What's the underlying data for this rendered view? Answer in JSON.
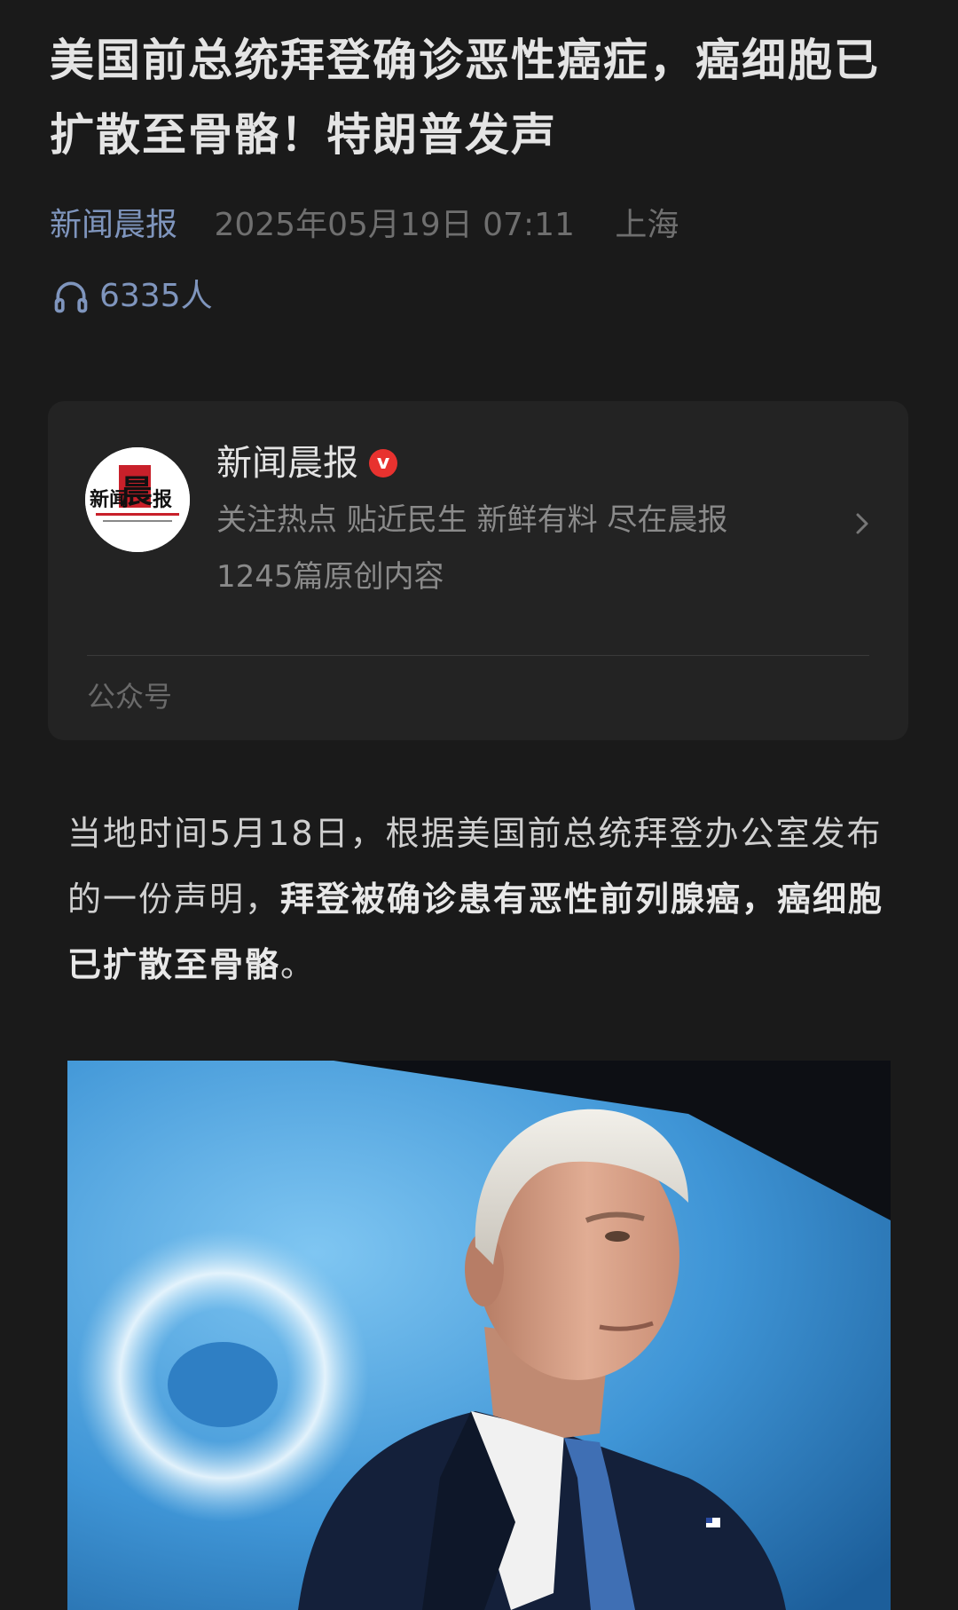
{
  "article": {
    "title": "美国前总统拜登确诊恶性癌症，癌细胞已扩散至骨骼！特朗普发声",
    "source": "新闻晨报",
    "date": "2025年05月19日 07:11",
    "location": "上海",
    "listeners": "6335人"
  },
  "account_card": {
    "name": "新闻晨报",
    "verified_badge": "v",
    "description": "关注热点 贴近民生 新鲜有料 尽在晨报",
    "original_count": "1245篇原创内容",
    "type": "公众号",
    "logo_text": "新闻晨报"
  },
  "body": {
    "para_plain": "当地时间5月18日，根据美国前总统拜登办公室发布的一份声明，",
    "para_bold": "拜登被确诊患有恶性前列腺癌，癌细胞已扩散至骨骼",
    "para_end": "。"
  },
  "colors": {
    "background": "#1a1a1a",
    "card": "#232323",
    "source_blue": "#7f95bd",
    "verified_red": "#e8322f"
  },
  "icons": [
    "headphones-icon",
    "verified-icon",
    "chevron-right-icon"
  ]
}
